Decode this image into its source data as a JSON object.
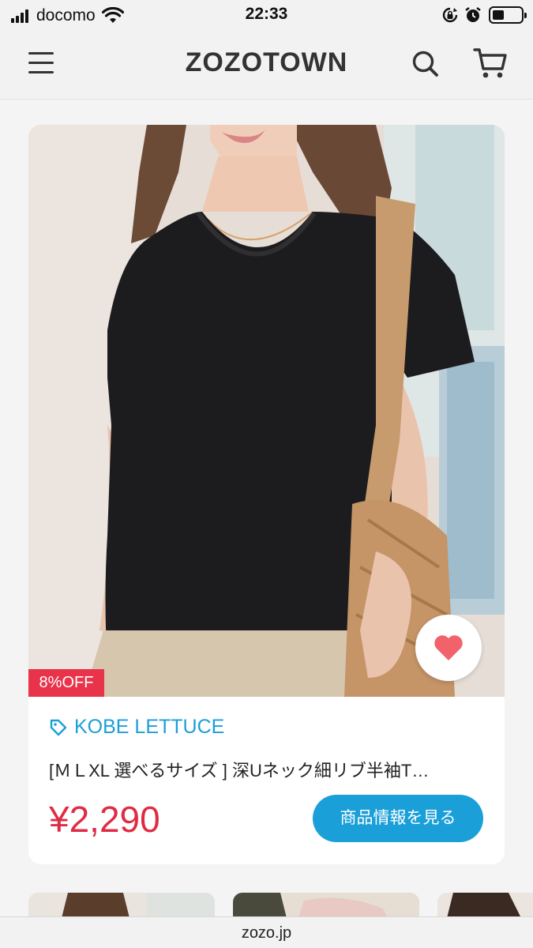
{
  "status_bar": {
    "carrier": "docomo",
    "time": "22:33",
    "icons": [
      "signal-icon",
      "wifi-icon",
      "rotation-lock-icon",
      "alarm-icon",
      "battery-icon"
    ]
  },
  "header": {
    "logo": "ZOZOTOWN",
    "icons": [
      "menu-icon",
      "search-icon",
      "cart-icon"
    ]
  },
  "product": {
    "discount": "8%OFF",
    "brand": "KOBE LETTUCE",
    "name": "[ＭＬXL 選べるサイズ ] 深Uネック細リブ半袖T…",
    "price": "¥2,290",
    "cta": "商品情報を見る",
    "favorite_icon": "heart-icon",
    "brand_icon": "tag-icon"
  },
  "browser": {
    "url": "zozo.jp"
  },
  "colors": {
    "accent": "#1b9fd8",
    "price": "#e02b44",
    "badge": "#e8334a",
    "favorite": "#f2626b"
  }
}
